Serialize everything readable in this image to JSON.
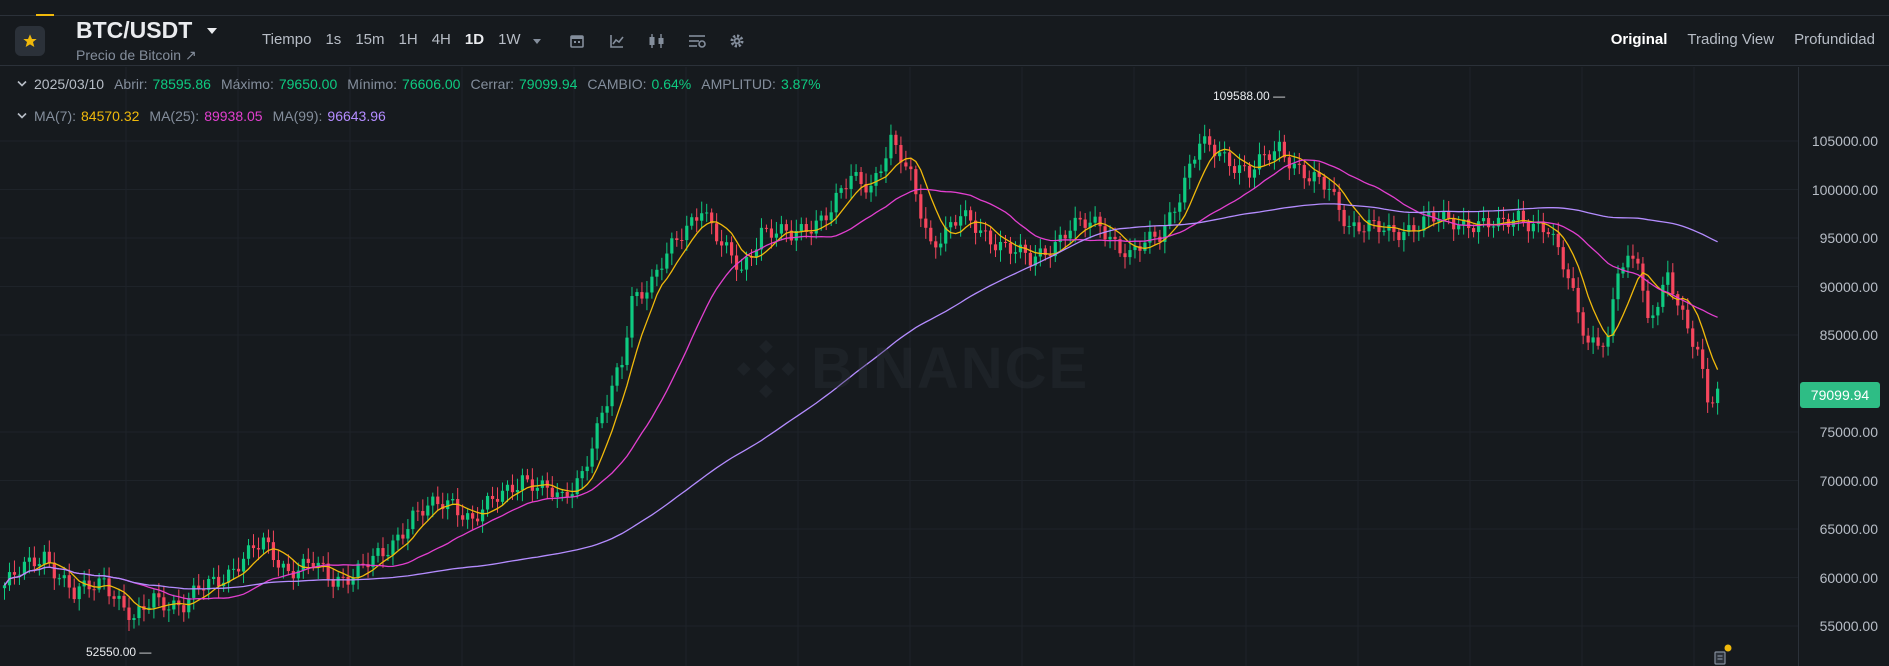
{
  "header": {
    "symbol": "BTC/USDT",
    "subtitle": "Precio de Bitcoin ↗",
    "intervals": [
      {
        "label": "Tiempo",
        "active": false
      },
      {
        "label": "1s",
        "active": false
      },
      {
        "label": "15m",
        "active": false
      },
      {
        "label": "1H",
        "active": false
      },
      {
        "label": "4H",
        "active": false
      },
      {
        "label": "1D",
        "active": true
      },
      {
        "label": "1W",
        "active": false
      }
    ],
    "tools": [
      "chevron-down-icon",
      "calendar-icon",
      "indicators-icon",
      "candle-style-icon",
      "template-icon",
      "gear-icon"
    ],
    "views": [
      {
        "label": "Original",
        "active": true
      },
      {
        "label": "Trading View",
        "active": false
      },
      {
        "label": "Profundidad",
        "active": false
      }
    ]
  },
  "ohlc": {
    "date": "2025/03/10",
    "open_label": "Abrir:",
    "open": "78595.86",
    "high_label": "Máximo:",
    "high": "79650.00",
    "low_label": "Mínimo:",
    "low": "76606.00",
    "close_label": "Cerrar:",
    "close": "79099.94",
    "change_label": "CAMBIO:",
    "change": "0.64%",
    "amplitude_label": "AMPLITUD:",
    "amplitude": "3.87%"
  },
  "ma": {
    "ma7_label": "MA(7):",
    "ma7": "84570.32",
    "ma25_label": "MA(25):",
    "ma25": "89938.05",
    "ma99_label": "MA(99):",
    "ma99": "96643.96"
  },
  "chart_data": {
    "type": "candlestick",
    "y_ticks": [
      "105000.00",
      "100000.00",
      "95000.00",
      "90000.00",
      "85000.00",
      "75000.00",
      "70000.00",
      "65000.00",
      "60000.00",
      "55000.00"
    ],
    "y_tick_values": [
      105000,
      100000,
      95000,
      90000,
      85000,
      75000,
      70000,
      65000,
      60000,
      55000
    ],
    "ylim": [
      52000,
      112000
    ],
    "last_price": "79099.94",
    "max_annotation": "109588.00",
    "min_annotation": "52550.00",
    "series": [
      {
        "name": "MA(7)",
        "color": "#f0b90b"
      },
      {
        "name": "MA(25)",
        "color": "#e23fcf"
      },
      {
        "name": "MA(99)",
        "color": "#b48cff"
      }
    ],
    "colors": {
      "up": "#0ecb81",
      "down": "#f6465d"
    }
  },
  "watermark": "BINANCE"
}
